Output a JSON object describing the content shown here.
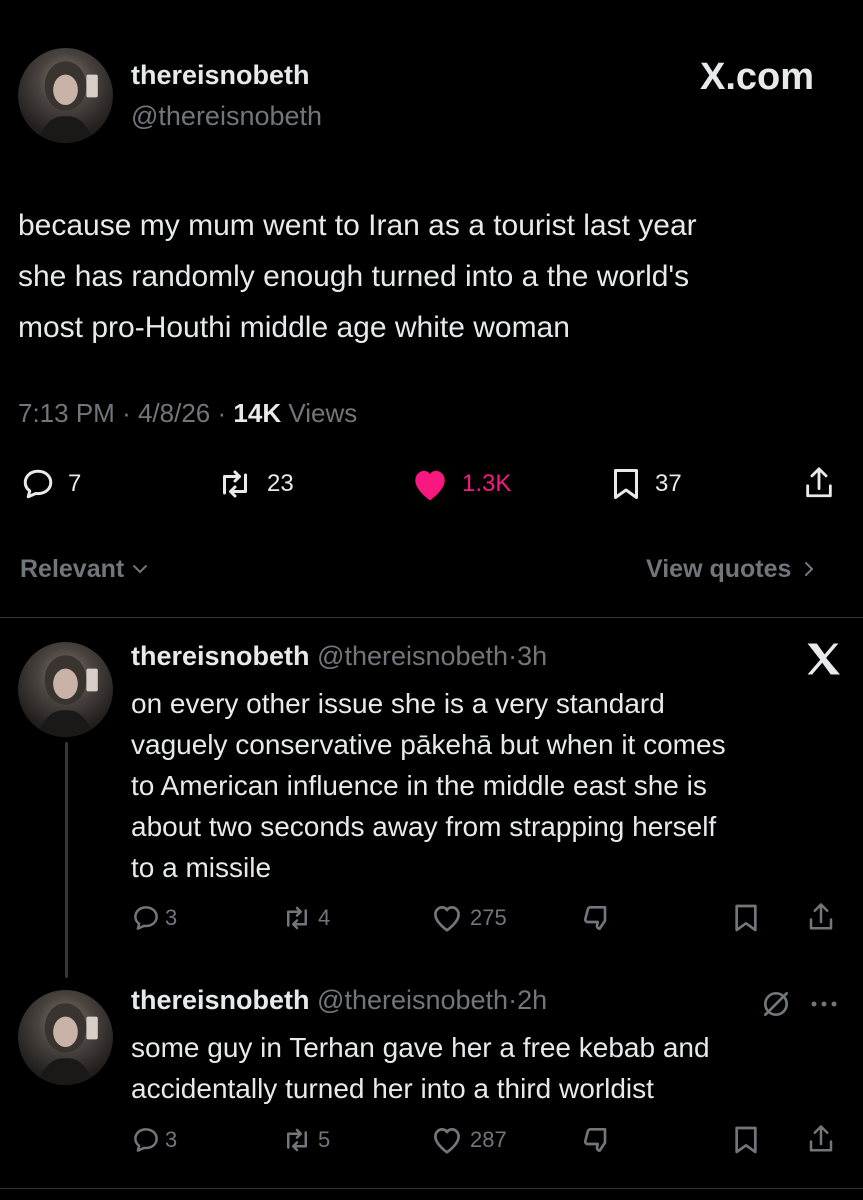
{
  "brand": {
    "label": "X.com"
  },
  "main_post": {
    "display_name": "thereisnobeth",
    "handle": "@thereisnobeth",
    "text_lines": [
      "because my mum went to Iran as a tourist last year",
      "she has randomly enough turned into a the world's",
      "most pro-Houthi middle age white woman"
    ],
    "time": "7:13 PM",
    "sep1": "·",
    "date": "4/8/26",
    "sep2": "·",
    "views_count": "14K",
    "views_label": "Views",
    "replies": "7",
    "reposts": "23",
    "likes": "1.3K",
    "bookmarks": "37"
  },
  "filters": {
    "sort_label": "Relevant",
    "quotes_label": "View quotes"
  },
  "replies": [
    {
      "display_name": "thereisnobeth",
      "handle": "@thereisnobeth",
      "sep": "·",
      "age": "3h",
      "text_lines": [
        "on every other issue she is a very standard",
        "vaguely conservative pākehā but when it comes",
        "to American influence in the middle east she is",
        "about two seconds away from strapping herself",
        "to a missile"
      ],
      "replies": "3",
      "reposts": "4",
      "likes": "275"
    },
    {
      "display_name": "thereisnobeth",
      "handle": "@thereisnobeth",
      "sep": "·",
      "age": "2h",
      "text_lines": [
        "some guy in Terhan gave her a free kebab and",
        "accidentally turned her into a third worldist"
      ],
      "replies": "3",
      "reposts": "5",
      "likes": "287"
    }
  ],
  "colors": {
    "background": "#000000",
    "text": "#e7e9ea",
    "muted": "#71767b",
    "like_active": "#f91880",
    "divider": "#2f3336"
  },
  "icons": [
    "x-logo-icon",
    "reply-icon",
    "repost-icon",
    "heart-filled-icon",
    "heart-icon",
    "bookmark-icon",
    "share-icon",
    "chevron-down-icon",
    "chevron-right-icon",
    "downvote-icon",
    "muted-icon",
    "more-icon"
  ]
}
